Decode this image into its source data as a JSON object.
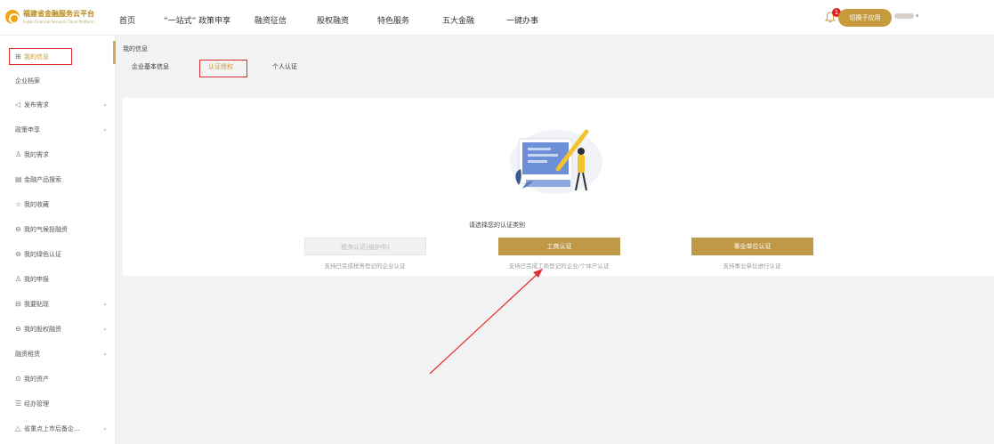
{
  "header": {
    "logo_text": "福建省金融服务云平台",
    "logo_subtitle": "Fujian Financial Services Cloud Platform",
    "nav": [
      "首页",
      "“一站式” 政策申享",
      "融资征信",
      "股权融资",
      "特色服务",
      "五大金融",
      "一键办事"
    ],
    "notification_count": "1",
    "switch_label": "切换子应用",
    "user_chevron": "▾"
  },
  "sidebar": {
    "items": [
      {
        "icon": "⊞",
        "label": "我的信息",
        "chev": ""
      },
      {
        "icon": "",
        "label": "企业档案",
        "chev": ""
      },
      {
        "icon": "◁",
        "label": "发布需求",
        "chev": "⌄"
      },
      {
        "icon": "",
        "label": "政策申享",
        "chev": "⌄"
      },
      {
        "icon": "♙",
        "label": "我的需求",
        "chev": ""
      },
      {
        "icon": "▤",
        "label": "金融产品搜索",
        "chev": ""
      },
      {
        "icon": "☆",
        "label": "我的收藏",
        "chev": ""
      },
      {
        "icon": "⊖",
        "label": "我的气候投融资",
        "chev": ""
      },
      {
        "icon": "⊖",
        "label": "我的绿色认证",
        "chev": ""
      },
      {
        "icon": "♙",
        "label": "我的申报",
        "chev": ""
      },
      {
        "icon": "⊟",
        "label": "我要贴现",
        "chev": "⌄"
      },
      {
        "icon": "⊖",
        "label": "我的股权融资",
        "chev": "⌄"
      },
      {
        "icon": "",
        "label": "融资租赁",
        "chev": "⌄"
      },
      {
        "icon": "⊙",
        "label": "我的资产",
        "chev": ""
      },
      {
        "icon": "☰",
        "label": "经办管理",
        "chev": ""
      },
      {
        "icon": "△",
        "label": "省重点上市后备企...",
        "chev": "⌄"
      }
    ]
  },
  "content": {
    "breadcrumb": "我的信息",
    "tabs": [
      "企业基本信息",
      "认证授权",
      "个人认证"
    ],
    "prompt": "请选择您的认证类别",
    "buttons": [
      {
        "label": "税务认证(维护中)",
        "desc": "支持已完成税务登记的企业认证"
      },
      {
        "label": "工商认证",
        "desc": "支持已完成工商登记的企业/个体户认证"
      },
      {
        "label": "事业单位认证",
        "desc": "支持事业单位进行认证"
      }
    ]
  },
  "colors": {
    "accent_gold": "#bf9947",
    "highlight_red": "#d92d2d",
    "logo_orange": "#f2a514"
  }
}
